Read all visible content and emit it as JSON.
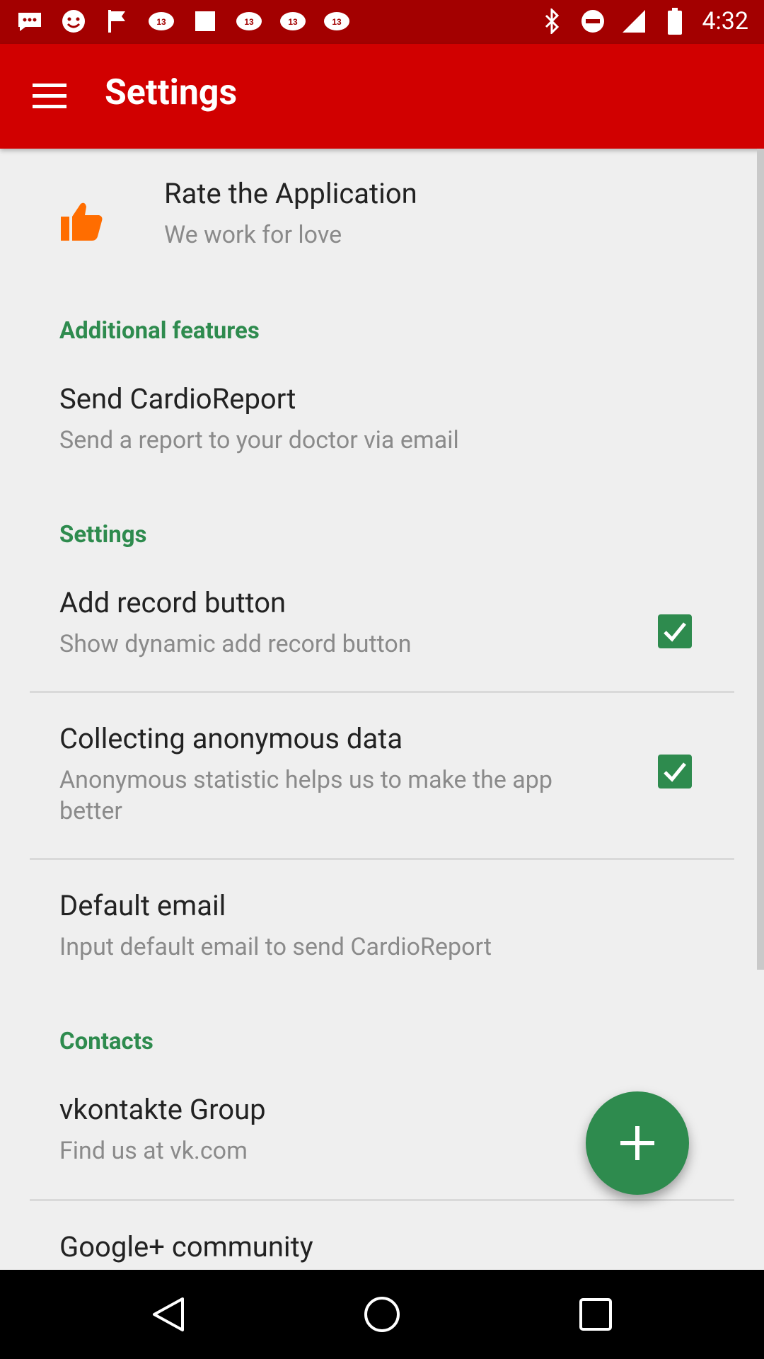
{
  "status_bar": {
    "time": "4:32",
    "left_icons": [
      "chat-icon",
      "face-icon",
      "flag-icon",
      "news-icon",
      "app-icon",
      "news-icon",
      "news-icon",
      "tv-icon"
    ],
    "right_icons": [
      "bluetooth-icon",
      "dnd-icon",
      "signal-icon",
      "battery-icon"
    ]
  },
  "app_bar": {
    "title": "Settings",
    "menu_icon": "hamburger-menu-icon"
  },
  "rate": {
    "title": "Rate the Application",
    "subtitle": "We work for love",
    "icon": "thumbs-up-icon",
    "icon_color": "#ff6d00"
  },
  "sections": {
    "additional": "Additional features",
    "settings": "Settings",
    "contacts": "Contacts"
  },
  "send_report": {
    "title": "Send CardioReport",
    "subtitle": "Send a report to your doctor via email"
  },
  "add_record": {
    "title": "Add record button",
    "subtitle": "Show dynamic add record button",
    "checked": true
  },
  "anon_data": {
    "title": "Collecting anonymous data",
    "subtitle": "Anonymous statistic helps us to make the app better",
    "checked": true
  },
  "default_email": {
    "title": "Default email",
    "subtitle": "Input default email to send CardioReport"
  },
  "vk": {
    "title": "vkontakte Group",
    "subtitle": "Find us at vk.com"
  },
  "gplus": {
    "title": "Google+ community"
  },
  "colors": {
    "app_bar": "#d10000",
    "status_bar": "#a30000",
    "accent": "#2e8b4e"
  },
  "nav": {
    "back_icon": "back-triangle-icon",
    "home_icon": "home-circle-icon",
    "recents_icon": "recents-square-icon"
  }
}
